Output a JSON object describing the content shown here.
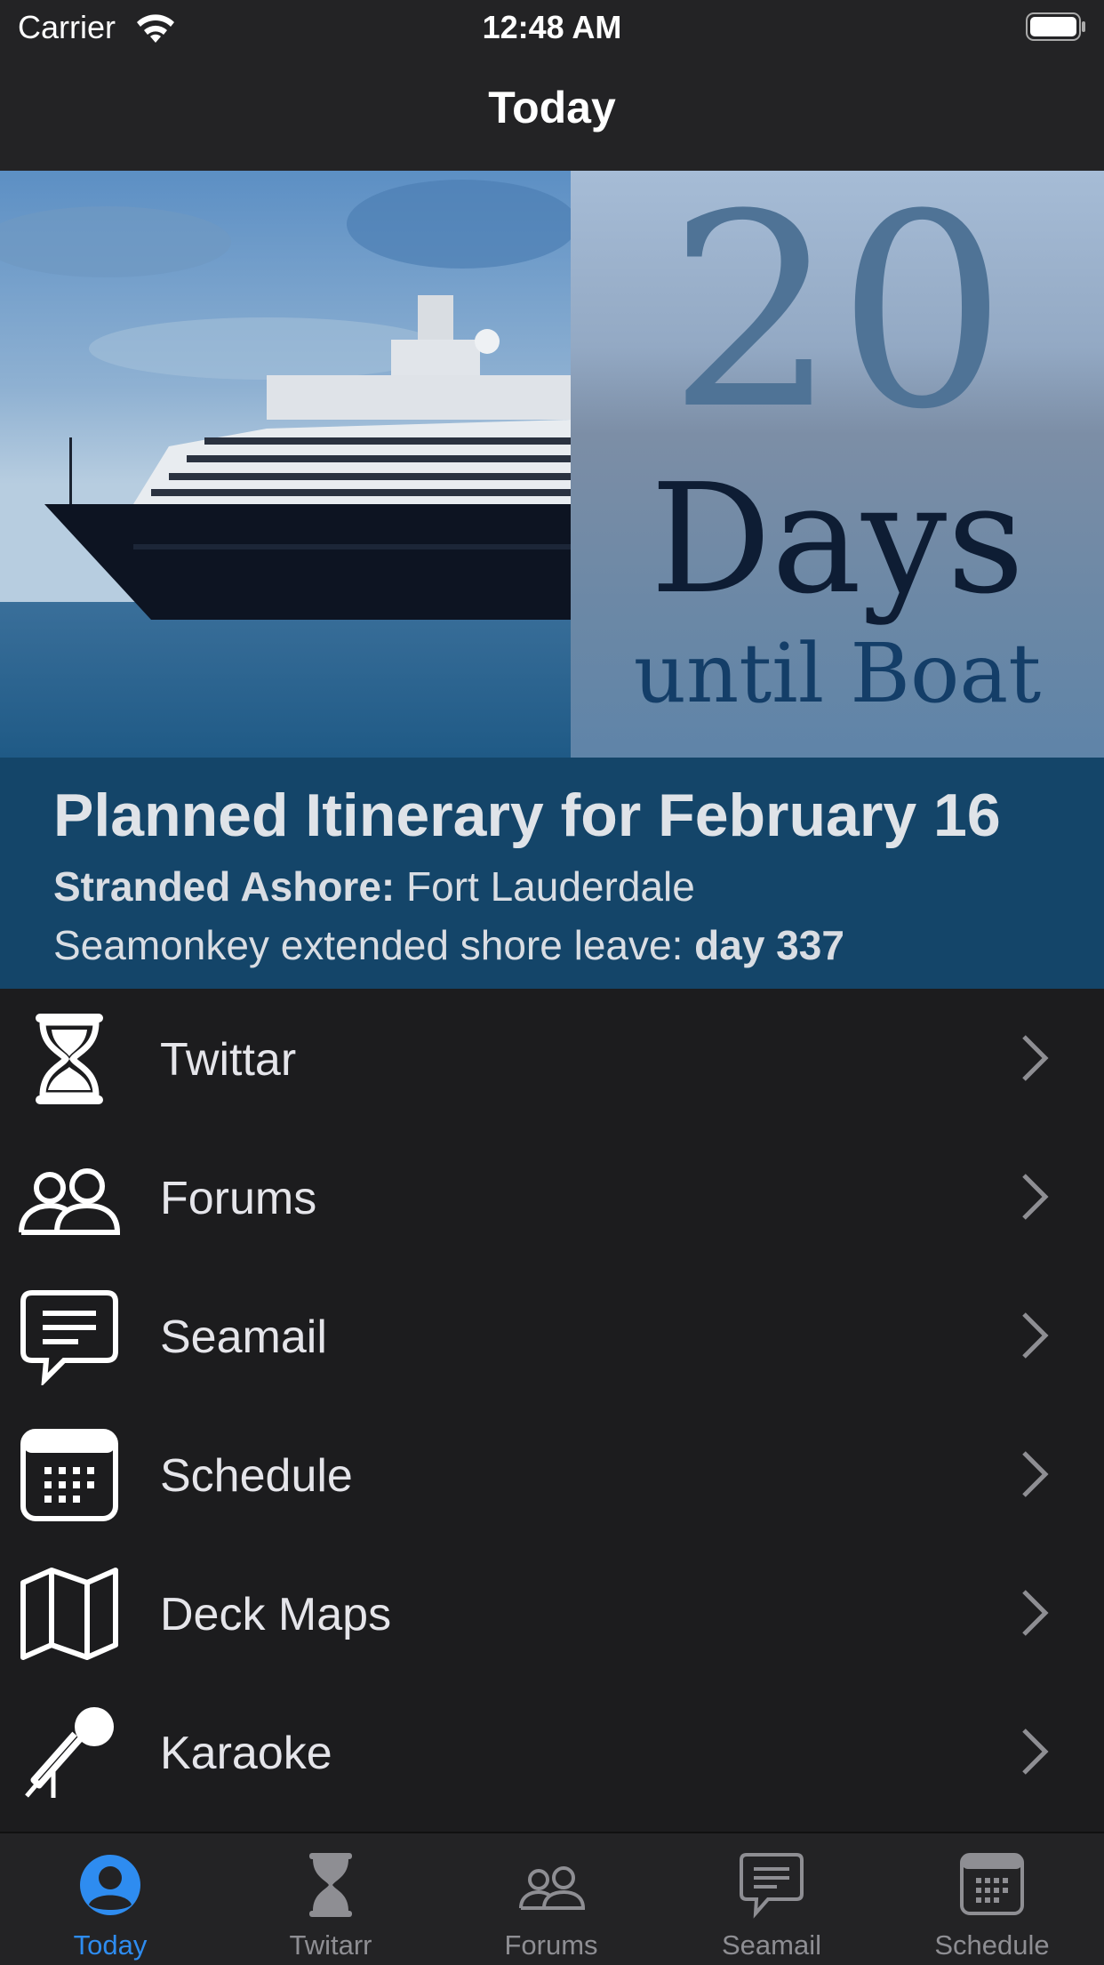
{
  "status_bar": {
    "carrier": "Carrier",
    "time": "12:48 AM"
  },
  "nav": {
    "title": "Today"
  },
  "countdown": {
    "number": "20",
    "unit": "Days",
    "suffix": "until Boat"
  },
  "itinerary": {
    "title": "Planned Itinerary for February 16",
    "stranded_label": "Stranded Ashore:",
    "stranded_value": "Fort Lauderdale",
    "leave_label": "Seamonkey extended shore leave:",
    "leave_value": "day 337"
  },
  "menu": [
    {
      "label": "Twittar",
      "icon": "hourglass-icon"
    },
    {
      "label": "Forums",
      "icon": "people-icon"
    },
    {
      "label": "Seamail",
      "icon": "chat-bubble-icon"
    },
    {
      "label": "Schedule",
      "icon": "calendar-icon"
    },
    {
      "label": "Deck Maps",
      "icon": "map-icon"
    },
    {
      "label": "Karaoke",
      "icon": "microphone-icon"
    }
  ],
  "tabs": [
    {
      "label": "Today",
      "icon": "person-circle-icon",
      "active": true
    },
    {
      "label": "Twitarr",
      "icon": "hourglass-icon",
      "active": false
    },
    {
      "label": "Forums",
      "icon": "people-icon",
      "active": false
    },
    {
      "label": "Seamail",
      "icon": "chat-bubble-icon",
      "active": false
    },
    {
      "label": "Schedule",
      "icon": "calendar-icon",
      "active": false
    }
  ],
  "colors": {
    "accent": "#2e8cf0",
    "itinerary_bg": "#144569",
    "background": "#1c1c1e"
  }
}
